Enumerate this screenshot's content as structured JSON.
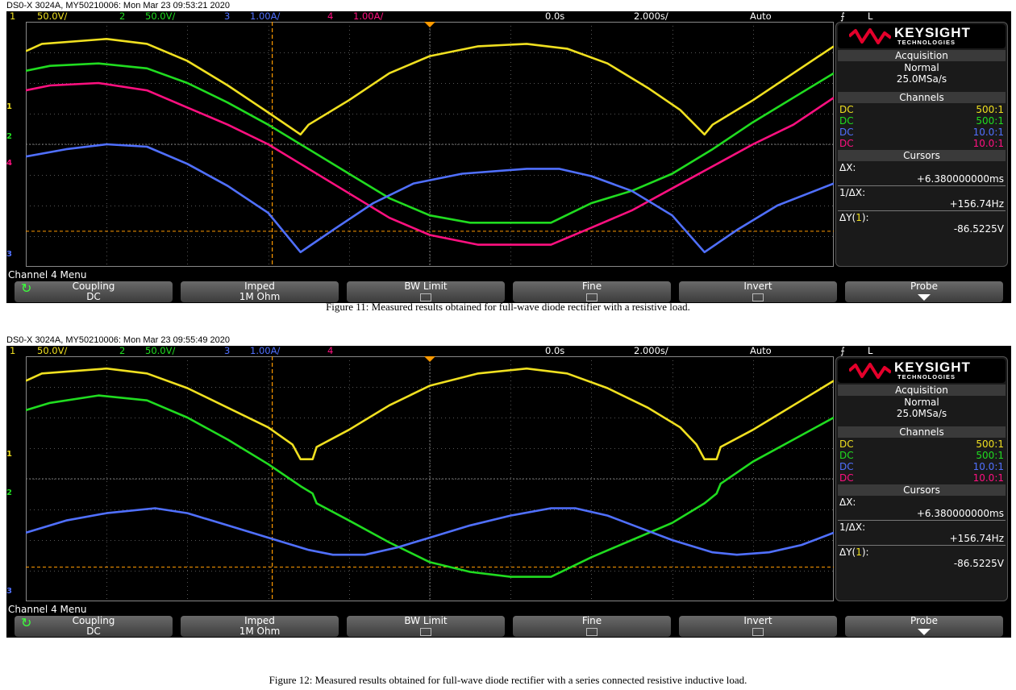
{
  "colors": {
    "ch1": "#f0e020",
    "ch2": "#20dc20",
    "ch3": "#5070ff",
    "ch4": "#ff1080",
    "trigger": "#ff9a00",
    "cursor": "#ff9a00",
    "grid": "#555555"
  },
  "icons": {
    "trigger_edge": "rising-edge-icon",
    "brand_wave": "keysight-wave-logo",
    "coupling_cycle": "cycle-arrow-icon",
    "probe_arrow": "down-arrow-icon"
  },
  "scopes": [
    {
      "title": "DS0-X 3024A, MY50210006: Mon Mar 23 09:53:21 2020",
      "status": {
        "ch1_num": "1",
        "ch1_scale": "50.0V/",
        "ch2_num": "2",
        "ch2_scale": "50.0V/",
        "ch3_num": "3",
        "ch3_scale": "1.00A/",
        "ch4_num": "4",
        "ch4_scale": "1.00A/",
        "delay": "0.0s",
        "timebase": "2.000s/",
        "mode": "Auto",
        "trigger_symbol": "⨍",
        "trigger_level": "L"
      },
      "markers": [
        {
          "label": "1",
          "color_key": "ch1",
          "level": 0.35
        },
        {
          "label": "2",
          "color_key": "ch2",
          "level": 0.47
        },
        {
          "label": "4",
          "color_key": "ch4",
          "level": 0.58
        },
        {
          "label": "3",
          "color_key": "ch3",
          "level": 0.95
        }
      ],
      "traces": [
        {
          "channel": "1",
          "color_key": "ch1",
          "points": [
            [
              0,
              0.12
            ],
            [
              0.02,
              0.09
            ],
            [
              0.1,
              0.07
            ],
            [
              0.15,
              0.09
            ],
            [
              0.2,
              0.16
            ],
            [
              0.25,
              0.26
            ],
            [
              0.3,
              0.37
            ],
            [
              0.34,
              0.46
            ],
            [
              0.35,
              0.42
            ],
            [
              0.4,
              0.32
            ],
            [
              0.45,
              0.21
            ],
            [
              0.5,
              0.14
            ],
            [
              0.56,
              0.1
            ],
            [
              0.62,
              0.09
            ],
            [
              0.67,
              0.11
            ],
            [
              0.72,
              0.17
            ],
            [
              0.77,
              0.27
            ],
            [
              0.81,
              0.36
            ],
            [
              0.84,
              0.46
            ],
            [
              0.85,
              0.42
            ],
            [
              0.9,
              0.32
            ],
            [
              0.95,
              0.21
            ],
            [
              1,
              0.1
            ]
          ]
        },
        {
          "channel": "2",
          "color_key": "ch2",
          "points": [
            [
              0,
              0.2
            ],
            [
              0.03,
              0.18
            ],
            [
              0.09,
              0.17
            ],
            [
              0.15,
              0.19
            ],
            [
              0.2,
              0.25
            ],
            [
              0.25,
              0.33
            ],
            [
              0.3,
              0.42
            ],
            [
              0.34,
              0.5
            ],
            [
              0.4,
              0.62
            ],
            [
              0.45,
              0.72
            ],
            [
              0.5,
              0.79
            ],
            [
              0.55,
              0.82
            ],
            [
              0.65,
              0.82
            ],
            [
              0.7,
              0.74
            ],
            [
              0.75,
              0.69
            ],
            [
              0.8,
              0.62
            ],
            [
              0.85,
              0.52
            ],
            [
              0.9,
              0.41
            ],
            [
              0.95,
              0.31
            ],
            [
              1,
              0.21
            ]
          ]
        },
        {
          "channel": "4",
          "color_key": "ch4",
          "points": [
            [
              0,
              0.28
            ],
            [
              0.03,
              0.26
            ],
            [
              0.09,
              0.25
            ],
            [
              0.15,
              0.28
            ],
            [
              0.2,
              0.35
            ],
            [
              0.25,
              0.42
            ],
            [
              0.3,
              0.5
            ],
            [
              0.34,
              0.58
            ],
            [
              0.4,
              0.7
            ],
            [
              0.45,
              0.8
            ],
            [
              0.5,
              0.87
            ],
            [
              0.56,
              0.91
            ],
            [
              0.65,
              0.91
            ],
            [
              0.7,
              0.84
            ],
            [
              0.75,
              0.77
            ],
            [
              0.8,
              0.68
            ],
            [
              0.85,
              0.59
            ],
            [
              0.9,
              0.5
            ],
            [
              0.95,
              0.42
            ],
            [
              1,
              0.31
            ]
          ]
        },
        {
          "channel": "3",
          "color_key": "ch3",
          "points": [
            [
              0,
              0.55
            ],
            [
              0.05,
              0.52
            ],
            [
              0.1,
              0.5
            ],
            [
              0.15,
              0.51
            ],
            [
              0.2,
              0.58
            ],
            [
              0.25,
              0.67
            ],
            [
              0.3,
              0.78
            ],
            [
              0.34,
              0.94
            ],
            [
              0.38,
              0.85
            ],
            [
              0.43,
              0.74
            ],
            [
              0.48,
              0.66
            ],
            [
              0.54,
              0.62
            ],
            [
              0.62,
              0.6
            ],
            [
              0.66,
              0.6
            ],
            [
              0.7,
              0.63
            ],
            [
              0.75,
              0.69
            ],
            [
              0.8,
              0.79
            ],
            [
              0.84,
              0.94
            ],
            [
              0.88,
              0.85
            ],
            [
              0.93,
              0.75
            ],
            [
              1,
              0.66
            ]
          ]
        }
      ],
      "cursor_x": 0.305,
      "cursor_y": 0.855,
      "trigger_x": 0.5,
      "panel": {
        "brand": "KEYSIGHT",
        "brand_sub": "TECHNOLOGIES",
        "acq_head": "Acquisition",
        "acq_mode": "Normal",
        "acq_rate": "25.0MSa/s",
        "ch_head": "Channels",
        "channels": [
          {
            "coupling": "DC",
            "probe": "500:1",
            "color_key": "ch1"
          },
          {
            "coupling": "DC",
            "probe": "500:1",
            "color_key": "ch2"
          },
          {
            "coupling": "DC",
            "probe": "10.0:1",
            "color_key": "ch3"
          },
          {
            "coupling": "DC",
            "probe": "10.0:1",
            "color_key": "ch4"
          }
        ],
        "cur_head": "Cursors",
        "dx_label": "ΔX:",
        "dx_value": "+6.380000000ms",
        "inv_label": "1/ΔX:",
        "inv_value": "+156.74Hz",
        "dy_label_pre": "ΔY(",
        "dy_label_num": "1",
        "dy_label_post": "):",
        "dy_value": "-86.5225V"
      },
      "menu_label": "Channel 4 Menu",
      "softkeys": [
        {
          "label": "Coupling",
          "value": "DC"
        },
        {
          "label": "Imped",
          "value": "1M Ohm"
        },
        {
          "label": "BW Limit",
          "value": ""
        },
        {
          "label": "Fine",
          "value": ""
        },
        {
          "label": "Invert",
          "value": ""
        },
        {
          "label": "Probe",
          "value": ""
        }
      ],
      "caption": "Figure 11: Measured results obtained for full-wave diode rectifier with a resistive load."
    },
    {
      "title": "DS0-X 3024A, MY50210006: Mon Mar 23 09:55:49 2020",
      "status": {
        "ch1_num": "1",
        "ch1_scale": "50.0V/",
        "ch2_num": "2",
        "ch2_scale": "50.0V/",
        "ch3_num": "3",
        "ch3_scale": "1.00A/",
        "ch4_num": "4",
        "ch4_scale": "",
        "delay": "0.0s",
        "timebase": "2.000s/",
        "mode": "Auto",
        "trigger_symbol": "⨍",
        "trigger_level": "L"
      },
      "markers": [
        {
          "label": "1",
          "color_key": "ch1",
          "level": 0.4
        },
        {
          "label": "2",
          "color_key": "ch2",
          "level": 0.56
        },
        {
          "label": "3",
          "color_key": "ch3",
          "level": 0.96
        }
      ],
      "traces": [
        {
          "channel": "1",
          "color_key": "ch1",
          "points": [
            [
              0,
              0.1
            ],
            [
              0.02,
              0.07
            ],
            [
              0.1,
              0.05
            ],
            [
              0.15,
              0.07
            ],
            [
              0.2,
              0.13
            ],
            [
              0.25,
              0.21
            ],
            [
              0.3,
              0.29
            ],
            [
              0.33,
              0.36
            ],
            [
              0.34,
              0.42
            ],
            [
              0.355,
              0.42
            ],
            [
              0.36,
              0.37
            ],
            [
              0.4,
              0.3
            ],
            [
              0.45,
              0.2
            ],
            [
              0.5,
              0.12
            ],
            [
              0.56,
              0.07
            ],
            [
              0.62,
              0.05
            ],
            [
              0.67,
              0.07
            ],
            [
              0.72,
              0.13
            ],
            [
              0.77,
              0.21
            ],
            [
              0.81,
              0.29
            ],
            [
              0.83,
              0.36
            ],
            [
              0.84,
              0.42
            ],
            [
              0.855,
              0.42
            ],
            [
              0.86,
              0.37
            ],
            [
              0.9,
              0.3
            ],
            [
              0.95,
              0.2
            ],
            [
              1,
              0.1
            ]
          ]
        },
        {
          "channel": "2",
          "color_key": "ch2",
          "points": [
            [
              0,
              0.22
            ],
            [
              0.03,
              0.19
            ],
            [
              0.09,
              0.16
            ],
            [
              0.15,
              0.18
            ],
            [
              0.2,
              0.25
            ],
            [
              0.25,
              0.34
            ],
            [
              0.3,
              0.44
            ],
            [
              0.34,
              0.53
            ],
            [
              0.355,
              0.56
            ],
            [
              0.36,
              0.6
            ],
            [
              0.4,
              0.67
            ],
            [
              0.45,
              0.76
            ],
            [
              0.5,
              0.84
            ],
            [
              0.55,
              0.88
            ],
            [
              0.6,
              0.9
            ],
            [
              0.65,
              0.9
            ],
            [
              0.7,
              0.82
            ],
            [
              0.75,
              0.75
            ],
            [
              0.8,
              0.68
            ],
            [
              0.84,
              0.6
            ],
            [
              0.855,
              0.56
            ],
            [
              0.86,
              0.52
            ],
            [
              0.9,
              0.43
            ],
            [
              0.95,
              0.34
            ],
            [
              1,
              0.25
            ]
          ]
        },
        {
          "channel": "3",
          "color_key": "ch3",
          "points": [
            [
              0,
              0.72
            ],
            [
              0.05,
              0.67
            ],
            [
              0.1,
              0.64
            ],
            [
              0.16,
              0.62
            ],
            [
              0.2,
              0.64
            ],
            [
              0.25,
              0.69
            ],
            [
              0.3,
              0.74
            ],
            [
              0.35,
              0.79
            ],
            [
              0.38,
              0.81
            ],
            [
              0.42,
              0.81
            ],
            [
              0.46,
              0.78
            ],
            [
              0.5,
              0.74
            ],
            [
              0.55,
              0.69
            ],
            [
              0.6,
              0.65
            ],
            [
              0.65,
              0.62
            ],
            [
              0.68,
              0.62
            ],
            [
              0.72,
              0.65
            ],
            [
              0.76,
              0.7
            ],
            [
              0.8,
              0.75
            ],
            [
              0.85,
              0.8
            ],
            [
              0.88,
              0.81
            ],
            [
              0.92,
              0.8
            ],
            [
              0.96,
              0.77
            ],
            [
              1,
              0.72
            ]
          ]
        }
      ],
      "cursor_x": 0.305,
      "cursor_y": 0.86,
      "trigger_x": 0.5,
      "panel": {
        "brand": "KEYSIGHT",
        "brand_sub": "TECHNOLOGIES",
        "acq_head": "Acquisition",
        "acq_mode": "Normal",
        "acq_rate": "25.0MSa/s",
        "ch_head": "Channels",
        "channels": [
          {
            "coupling": "DC",
            "probe": "500:1",
            "color_key": "ch1"
          },
          {
            "coupling": "DC",
            "probe": "500:1",
            "color_key": "ch2"
          },
          {
            "coupling": "DC",
            "probe": "10.0:1",
            "color_key": "ch3"
          },
          {
            "coupling": "DC",
            "probe": "10.0:1",
            "color_key": "ch4"
          }
        ],
        "cur_head": "Cursors",
        "dx_label": "ΔX:",
        "dx_value": "+6.380000000ms",
        "inv_label": "1/ΔX:",
        "inv_value": "+156.74Hz",
        "dy_label_pre": "ΔY(",
        "dy_label_num": "1",
        "dy_label_post": "):",
        "dy_value": "-86.5225V"
      },
      "menu_label": "Channel 4 Menu",
      "softkeys": [
        {
          "label": "Coupling",
          "value": "DC"
        },
        {
          "label": "Imped",
          "value": "1M Ohm"
        },
        {
          "label": "BW Limit",
          "value": ""
        },
        {
          "label": "Fine",
          "value": ""
        },
        {
          "label": "Invert",
          "value": ""
        },
        {
          "label": "Probe",
          "value": ""
        }
      ],
      "caption": "Figure 12: Measured results obtained for full-wave diode rectifier with a series connected resistive inductive load."
    }
  ]
}
